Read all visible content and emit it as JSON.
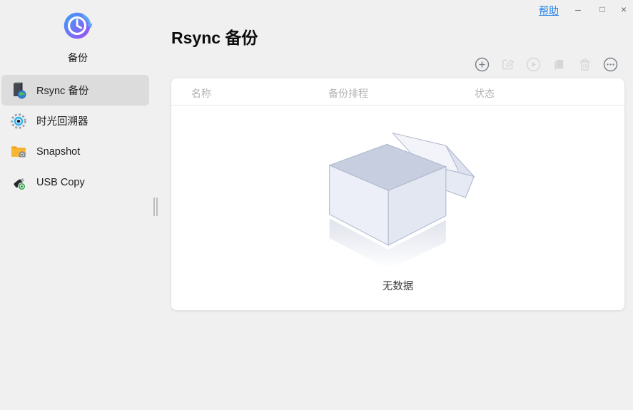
{
  "window": {
    "help_label": "帮助",
    "minimize_glyph": "–",
    "maximize_glyph": "□",
    "close_glyph": "×"
  },
  "sidebar": {
    "app": {
      "label": "备份",
      "icon": "backup-clock-icon"
    },
    "items": [
      {
        "label": "Rsync 备份",
        "icon": "rsync-server-globe-icon",
        "selected": true
      },
      {
        "label": "时光回溯器",
        "icon": "time-machine-gear-icon",
        "selected": false
      },
      {
        "label": "Snapshot",
        "icon": "snapshot-folder-camera-icon",
        "selected": false
      },
      {
        "label": "USB Copy",
        "icon": "usb-drive-icon",
        "selected": false
      }
    ]
  },
  "main": {
    "title": "Rsync 备份",
    "toolbar": {
      "buttons": [
        {
          "name": "add",
          "icon": "plus-circle-icon",
          "enabled": true
        },
        {
          "name": "edit",
          "icon": "edit-pencil-icon",
          "enabled": false
        },
        {
          "name": "run",
          "icon": "play-circle-icon",
          "enabled": false
        },
        {
          "name": "copy",
          "icon": "copy-document-icon",
          "enabled": false
        },
        {
          "name": "delete",
          "icon": "trash-icon",
          "enabled": false
        },
        {
          "name": "more",
          "icon": "ellipsis-circle-icon",
          "enabled": true
        }
      ]
    },
    "table": {
      "columns": [
        "名称",
        "备份排程",
        "状态"
      ]
    },
    "empty": {
      "illustration": "open-empty-box-icon",
      "label": "无数据"
    }
  },
  "colors": {
    "background": "#f0f0f0",
    "panel": "#ffffff",
    "selected_item_bg": "#dcdcdc",
    "link_blue": "#1e80e8",
    "header_text": "#b3b3b3",
    "toolbar_enabled": "#7a7f87",
    "toolbar_disabled": "#d6d6d6",
    "app_icon_gradient": [
      "#38a1f8",
      "#a24df0"
    ]
  }
}
